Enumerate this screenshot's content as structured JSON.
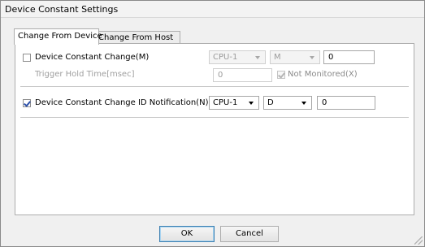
{
  "window": {
    "title": "Device Constant Settings"
  },
  "tabs": [
    {
      "label": "Change From Device",
      "active": true
    },
    {
      "label": "Change From Host",
      "active": false
    }
  ],
  "device_constant_change": {
    "label": "Device Constant Change(M)",
    "checked": false,
    "cpu_select": "CPU-1",
    "device_select": "M",
    "device_number": "0",
    "trigger_hold_label": "Trigger Hold Time[msec]",
    "trigger_hold_value": "0",
    "not_monitored_label": "Not Monitored(X)",
    "not_monitored_checked": true
  },
  "id_notification": {
    "label": "Device Constant Change ID Notification(N)",
    "checked": true,
    "cpu_select": "CPU-1",
    "device_select": "D",
    "device_number": "0"
  },
  "buttons": {
    "ok": "OK",
    "cancel": "Cancel"
  }
}
